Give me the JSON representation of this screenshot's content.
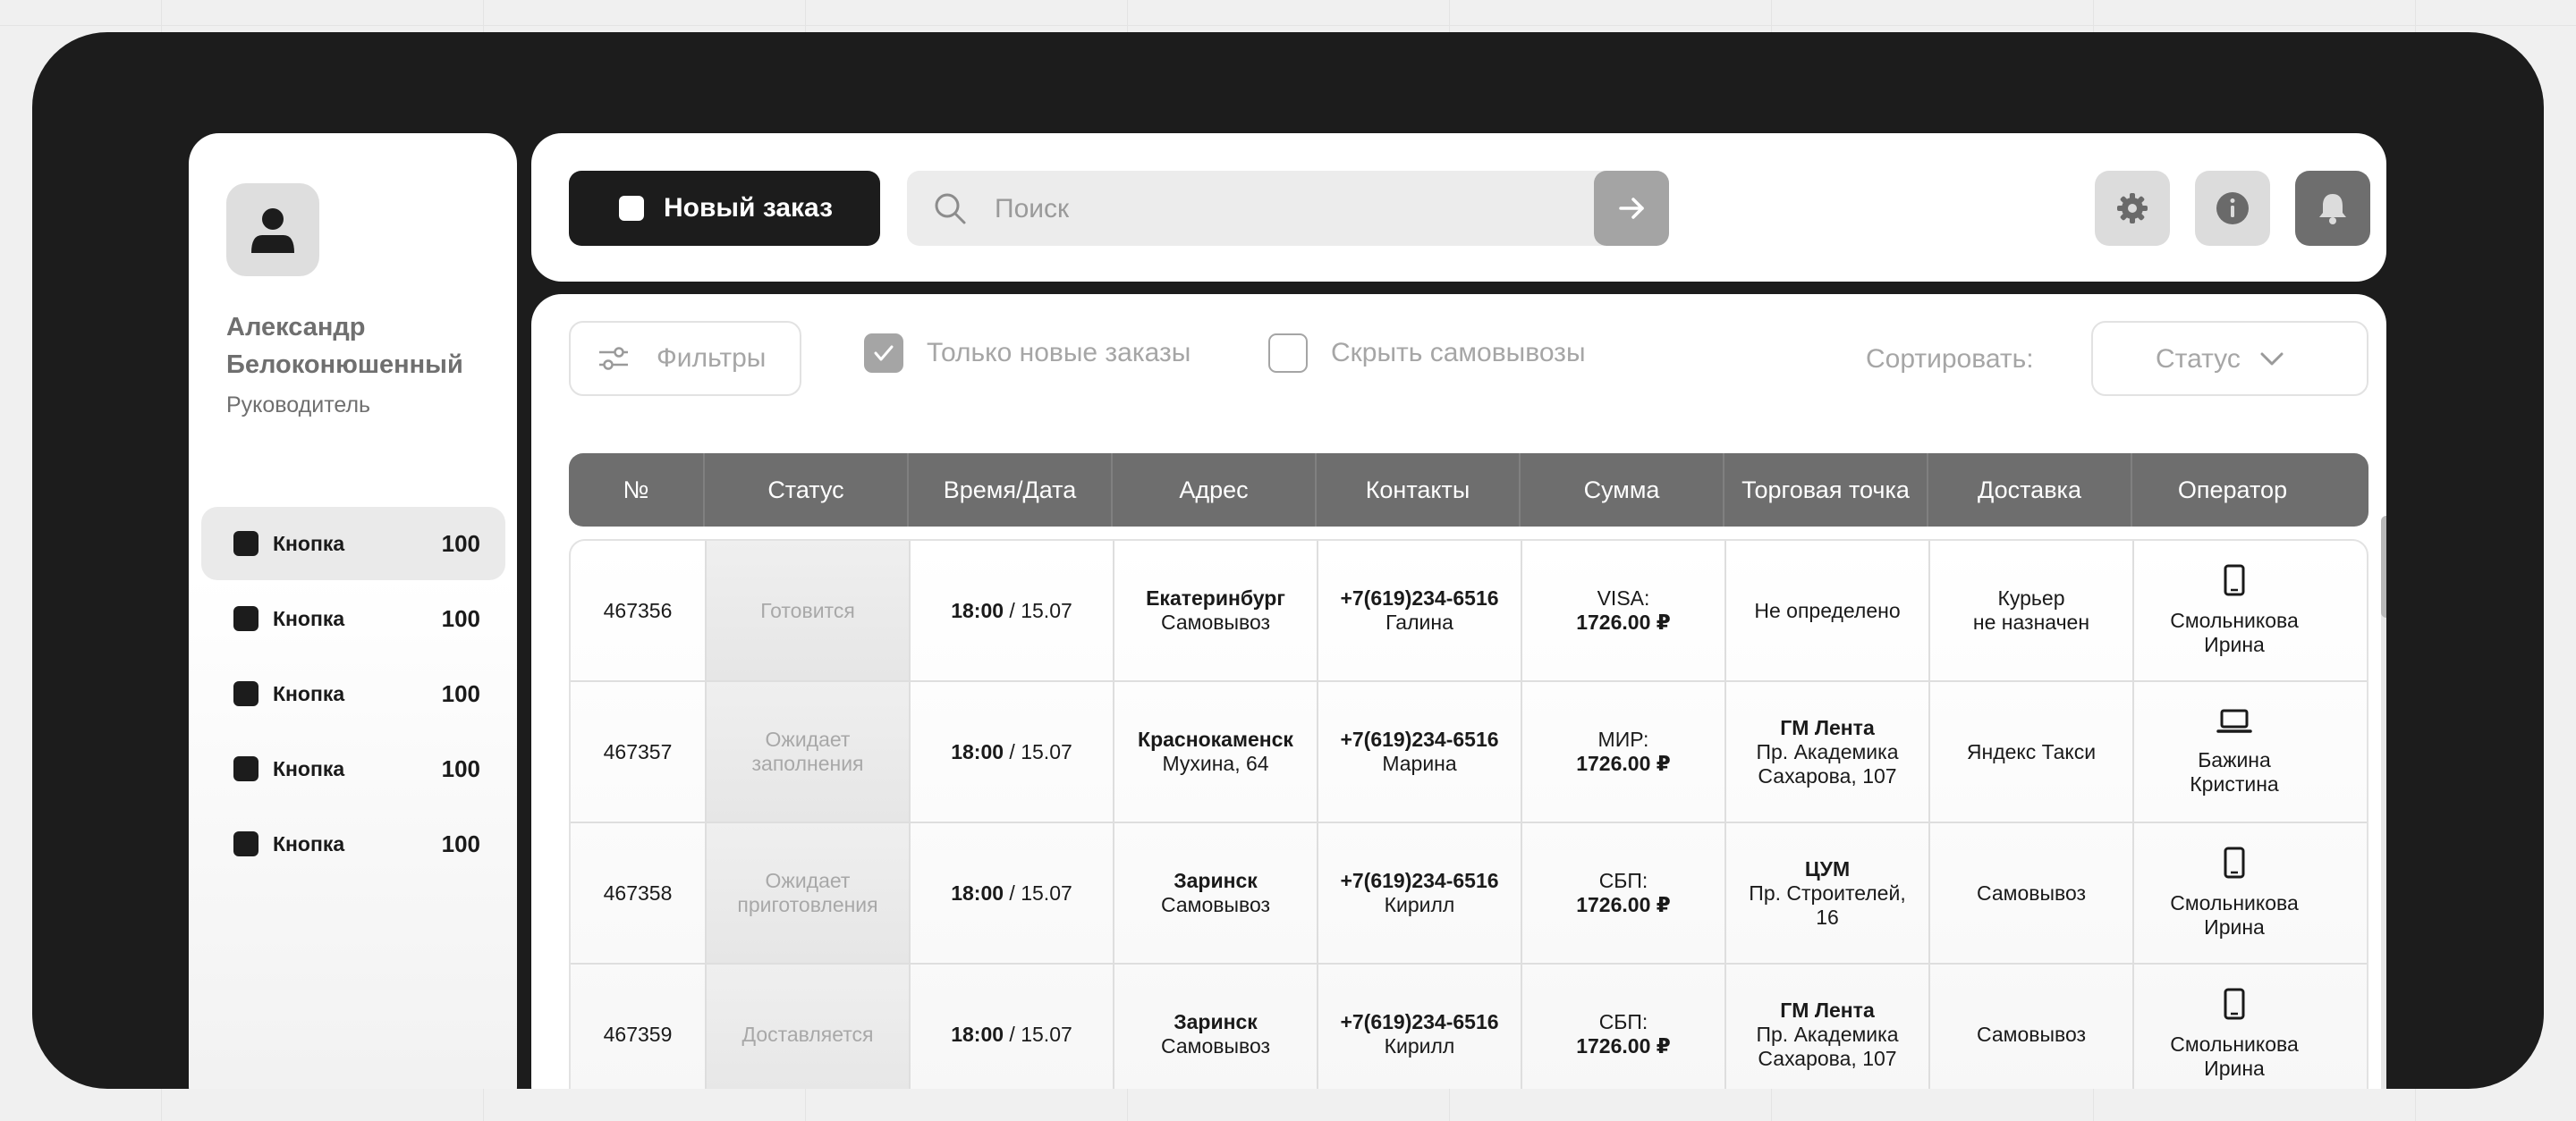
{
  "sidebar": {
    "user_name": "Александр Белоконюшенный",
    "user_role": "Руководитель",
    "items": [
      {
        "label": "Кнопка",
        "count": "100",
        "active": true
      },
      {
        "label": "Кнопка",
        "count": "100",
        "active": false
      },
      {
        "label": "Кнопка",
        "count": "100",
        "active": false
      },
      {
        "label": "Кнопка",
        "count": "100",
        "active": false
      },
      {
        "label": "Кнопка",
        "count": "100",
        "active": false
      }
    ]
  },
  "topbar": {
    "new_order_label": "Новый заказ",
    "search_placeholder": "Поиск",
    "icons": [
      "gear-icon",
      "info-icon",
      "bell-icon"
    ]
  },
  "toolbar": {
    "filters_label": "Фильтры",
    "only_new_label": "Только новые заказы",
    "only_new_checked": true,
    "hide_pickup_label": "Скрыть самовывозы",
    "hide_pickup_checked": false,
    "sort_label": "Сортировать:",
    "sort_value": "Статус"
  },
  "table": {
    "columns": [
      "№",
      "Статус",
      "Время/Дата",
      "Адрес",
      "Контакты",
      "Сумма",
      "Торговая точка",
      "Доставка",
      "Оператор"
    ],
    "rows": [
      {
        "id": "467356",
        "status": "Готовится",
        "time": "18:00",
        "date": " / 15.07",
        "city": "Екатеринбург",
        "address": "Самовывоз",
        "phone": "+7(619)234-6516",
        "contact": "Галина",
        "payment": "VISA:",
        "amount": "1726.00 ₽",
        "store_name": "",
        "store_address": "Не определено",
        "delivery": "Курьер\nне назначен",
        "operator_device": "phone-icon",
        "operator": "Смольникова Ирина"
      },
      {
        "id": "467357",
        "status": "Ожидает заполнения",
        "time": "18:00",
        "date": " / 15.07",
        "city": "Краснокаменск",
        "address": "Мухина, 64",
        "phone": "+7(619)234-6516",
        "contact": "Марина",
        "payment": "МИР:",
        "amount": "1726.00 ₽",
        "store_name": "ГМ Лента",
        "store_address": "Пр. Академика Сахарова, 107",
        "delivery": "Яндекс Такси",
        "operator_device": "laptop-icon",
        "operator": "Бажина Кристина"
      },
      {
        "id": "467358",
        "status": "Ожидает приготовления",
        "time": "18:00",
        "date": " / 15.07",
        "city": "Заринск",
        "address": "Самовывоз",
        "phone": "+7(619)234-6516",
        "contact": "Кирилл",
        "payment": "СБП:",
        "amount": "1726.00 ₽",
        "store_name": "ЦУМ",
        "store_address": "Пр. Строителей, 16",
        "delivery": "Самовывоз",
        "operator_device": "phone-icon",
        "operator": "Смольникова Ирина"
      },
      {
        "id": "467359",
        "status": "Доставляется",
        "time": "18:00",
        "date": " / 15.07",
        "city": "Заринск",
        "address": "Самовывоз",
        "phone": "+7(619)234-6516",
        "contact": "Кирилл",
        "payment": "СБП:",
        "amount": "1726.00 ₽",
        "store_name": "ГМ Лента",
        "store_address": "Пр. Академика Сахарова, 107",
        "delivery": "Самовывоз",
        "operator_device": "phone-icon",
        "operator": "Смольникова Ирина"
      }
    ]
  }
}
